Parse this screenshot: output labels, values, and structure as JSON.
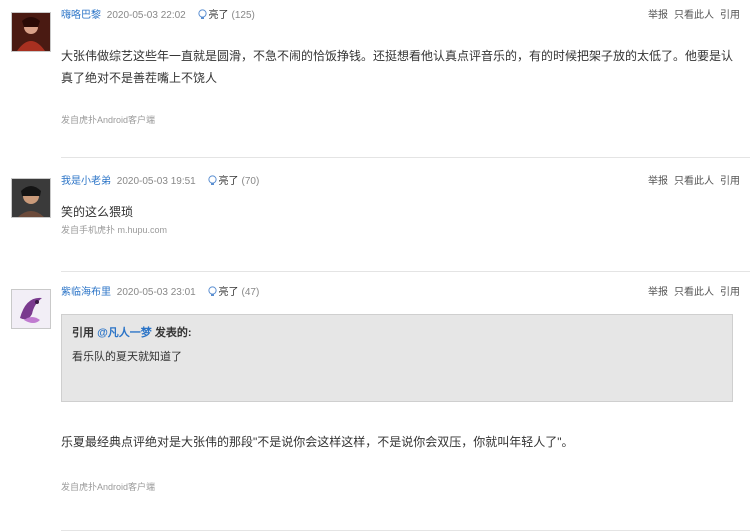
{
  "colors": {
    "link_blue": "#2b74c7",
    "meta_gray": "#888888",
    "quote_bg": "#e6e6e6"
  },
  "posts": [
    {
      "user": "嗨咯巴黎",
      "time": "2020-05-03 22:02",
      "light_label": "亮了",
      "light_count": "(125)",
      "actions": [
        "举报",
        "只看此人",
        "引用"
      ],
      "content": "大张伟做综艺这些年一直就是圆滑，不急不闹的恰饭挣钱。还挺想看他认真点评音乐的，有的时候把架子放的太低了。他要是认真了绝对不是善茬嘴上不饶人",
      "source": "发自虎扑Android客户端",
      "avatar_icon": "user-avatar-icon"
    },
    {
      "user": "我是小老弟",
      "time": "2020-05-03 19:51",
      "light_label": "亮了",
      "light_count": "(70)",
      "actions": [
        "举报",
        "只看此人",
        "引用"
      ],
      "content": "笑的这么猥琐",
      "source": "发自手机虎扑 m.hupu.com",
      "avatar_icon": "user-avatar-icon"
    },
    {
      "user": "紫临海布里",
      "time": "2020-05-03 23:01",
      "light_label": "亮了",
      "light_count": "(47)",
      "actions": [
        "举报",
        "只看此人",
        "引用"
      ],
      "quote": {
        "prefix": "引用 ",
        "user": "@凡人一梦",
        "suffix": " 发表的:",
        "body": "看乐队的夏天就知道了"
      },
      "content": "乐夏最经典点评绝对是大张伟的那段\"不是说你会这样这样，不是说你会双压，你就叫年轻人了\"。",
      "source": "发自虎扑Android客户端",
      "avatar_icon": "user-avatar-icon"
    }
  ]
}
